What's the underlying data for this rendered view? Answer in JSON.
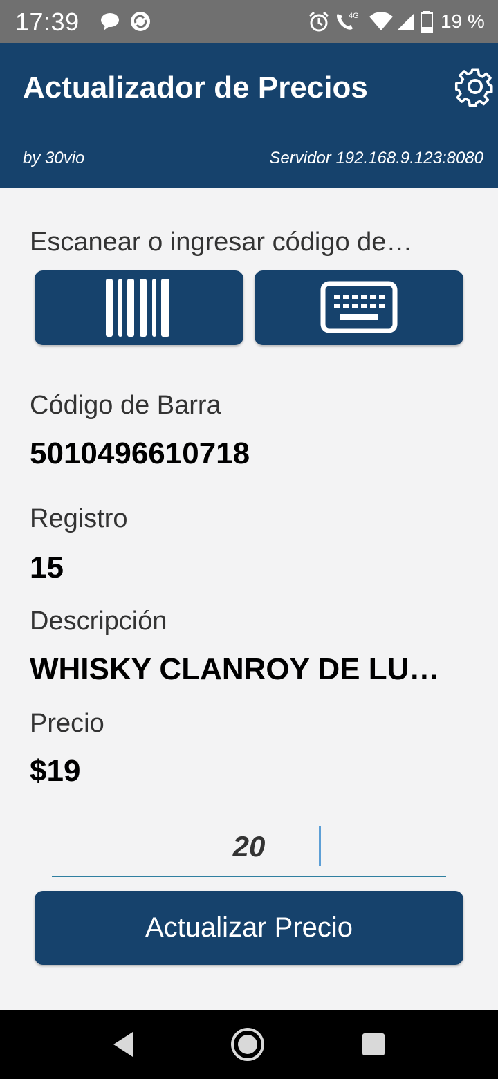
{
  "status_bar": {
    "time": "17:39",
    "network": "4G",
    "battery": "19 %"
  },
  "header": {
    "title": "Actualizador de Precios",
    "subtitle": "by 30vio",
    "server": "Servidor 192.168.9.123:8080",
    "settings_icon": "gear-icon"
  },
  "scan": {
    "prompt": "Escanear o ingresar código de…",
    "barcode_icon": "barcode-icon",
    "keyboard_icon": "keyboard-icon"
  },
  "product": {
    "barcode_label": "Código de Barra",
    "barcode_value": "5010496610718",
    "registro_label": "Registro",
    "registro_value": "15",
    "description_label": "Descripción",
    "description_value": "WHISKY CLANROY DE LUX…",
    "price_label": "Precio",
    "price_value": "$19"
  },
  "new_price": {
    "value": "20"
  },
  "update_button": {
    "label": "Actualizar Precio"
  },
  "colors": {
    "primary": "#16426c",
    "background": "#f3f3f4",
    "status_bar": "#707070",
    "input_underline": "#2f7fa0"
  }
}
